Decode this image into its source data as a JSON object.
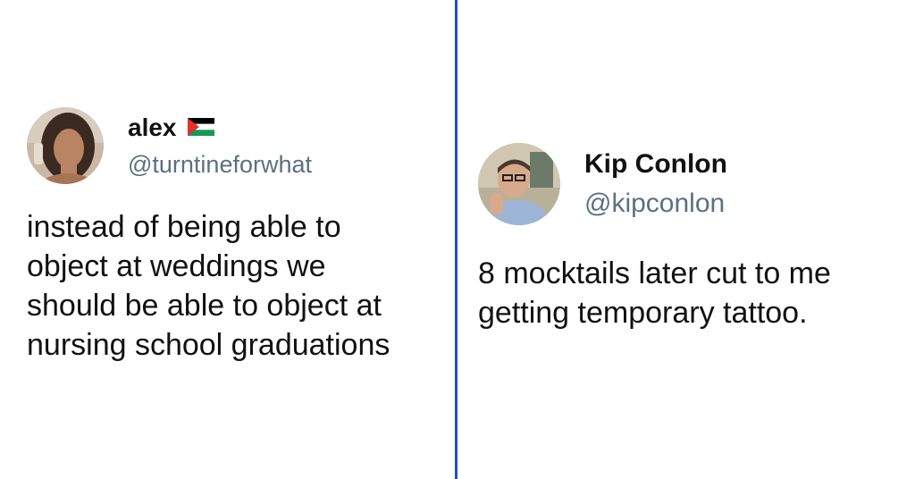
{
  "tweets": [
    {
      "name": "alex",
      "handle": "@turntineforwhat",
      "text_lines": [
        "instead of being able to",
        "object at weddings we",
        "should be able to object at",
        "nursing school graduations"
      ],
      "flag_icon": "palestine-flag-icon"
    },
    {
      "name": "Kip Conlon",
      "handle": "@kipconlon",
      "text_lines": [
        "8 mocktails later cut to me",
        "getting temporary tattoo."
      ]
    }
  ],
  "colors": {
    "divider": "#1f4fd1",
    "handle": "#5b7083",
    "text": "#111111"
  }
}
